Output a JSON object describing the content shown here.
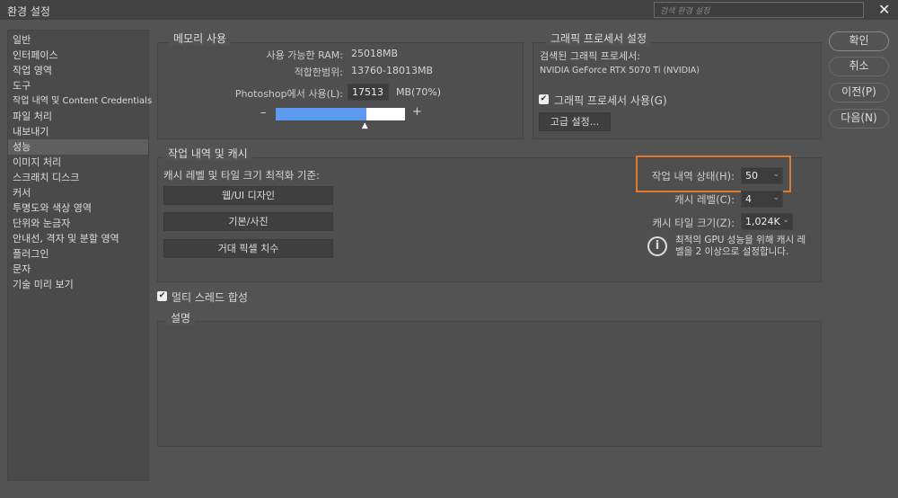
{
  "window": {
    "title": "환경 설정",
    "search_placeholder": "검색 환경 설정"
  },
  "sidebar": {
    "items": [
      {
        "label": "일반"
      },
      {
        "label": "인터페이스"
      },
      {
        "label": "작업 영역"
      },
      {
        "label": "도구"
      },
      {
        "label": "작업 내역 및 Content Credentials"
      },
      {
        "label": "파일 처리"
      },
      {
        "label": "내보내기"
      },
      {
        "label": "성능",
        "selected": true
      },
      {
        "label": "이미지 처리"
      },
      {
        "label": "스크래치 디스크"
      },
      {
        "label": "커서"
      },
      {
        "label": "투명도와 색상 영역"
      },
      {
        "label": "단위와 눈금자"
      },
      {
        "label": "안내선, 격자 및 분할 영역"
      },
      {
        "label": "플러그인"
      },
      {
        "label": "문자"
      },
      {
        "label": "기술 미리 보기"
      }
    ]
  },
  "memory": {
    "title": "메모리 사용",
    "available_label": "사용 가능한 RAM:",
    "available_value": "25018MB",
    "range_label": "적합한범위:",
    "range_value": "13760-18013MB",
    "use_label": "Photoshop에서 사용(L):",
    "use_value": "17513",
    "use_unit": "MB(70%)",
    "minus": "–",
    "plus": "+",
    "slider_percent": 70
  },
  "gpu": {
    "title": "그래픽 프로세서 설정",
    "detected_label": "검색된 그래픽 프로세서:",
    "detected_value": "NVIDIA GeForce RTX 5070 Ti (NVIDIA)",
    "use_gpu_label": "그래픽 프로세서 사용(G)",
    "use_gpu_checked": true,
    "advanced_label": "고급 설정..."
  },
  "cache": {
    "title": "작업 내역 및 캐시",
    "optimize_label": "캐시 레벨 및 타일 크기 최적화 기준:",
    "buttons": [
      "웹/UI 디자인",
      "기본/사진",
      "거대 픽셀 치수"
    ],
    "history_label": "작업 내역 상태(H):",
    "history_value": "50",
    "level_label": "캐시 레벨(C):",
    "level_value": "4",
    "tile_label": "캐시 타일 크기(Z):",
    "tile_value": "1,024K",
    "info_text_1": "최적의 GPU 성능을 위해 캐시 레",
    "info_text_2": "벨을 2 이상으로 설정합니다.",
    "highlight_color": "#e07a2e"
  },
  "multithread": {
    "label": "멀티 스레드 합성",
    "checked": true
  },
  "description": {
    "title": "설명"
  },
  "actions": {
    "ok": "확인",
    "cancel": "취소",
    "prev": "이전(P)",
    "next": "다음(N)"
  }
}
